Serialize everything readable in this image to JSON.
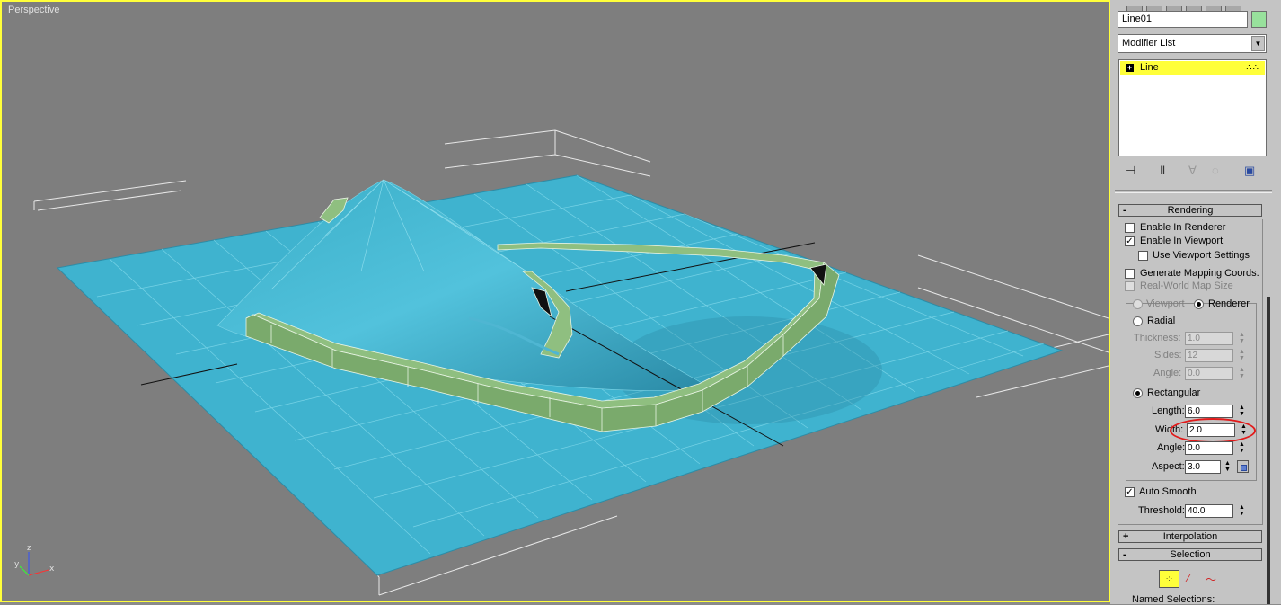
{
  "viewport": {
    "label": "Perspective",
    "axes": {
      "x": "x",
      "y": "y",
      "z": "z"
    }
  },
  "panel": {
    "object_name": "Line01",
    "object_color": "#98e19c",
    "modifier_list": "Modifier List",
    "stack": {
      "item": "Line"
    },
    "rendering": {
      "title": "Rendering",
      "collapse": "-",
      "enable_in_renderer": "Enable In Renderer",
      "enable_in_viewport": "Enable In Viewport",
      "use_viewport_settings": "Use Viewport Settings",
      "generate_mapping": "Generate Mapping Coords.",
      "real_world_map": "Real-World Map Size",
      "viewport_radio": "Viewport",
      "renderer_radio": "Renderer",
      "radial": "Radial",
      "thickness_label": "Thickness:",
      "thickness": "1.0",
      "sides_label": "Sides:",
      "sides": "12",
      "angle_label": "Angle:",
      "angle": "0.0",
      "rectangular": "Rectangular",
      "length_label": "Length:",
      "length": "6.0",
      "width_label": "Width:",
      "width": "2.0",
      "angle2_label": "Angle:",
      "angle2": "0.0",
      "aspect_label": "Aspect:",
      "aspect": "3.0",
      "auto_smooth": "Auto Smooth",
      "threshold_label": "Threshold:",
      "threshold": "40.0"
    },
    "interpolation": {
      "title": "Interpolation",
      "expand": "+"
    },
    "selection": {
      "title": "Selection",
      "collapse": "-",
      "named": "Named Selections:"
    }
  }
}
